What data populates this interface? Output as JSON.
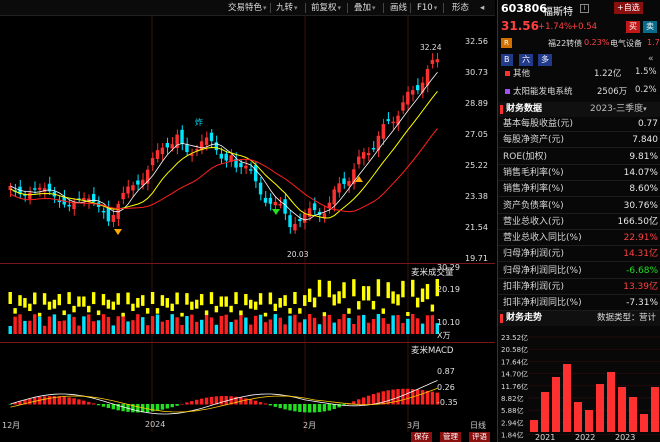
{
  "toolbar": {
    "trade_feature": "交易特色",
    "nine_turn": "九转",
    "pre_adjust": "前复权",
    "overlay": "叠加",
    "draw_line": "画线",
    "f10": "F10",
    "shape": "形态"
  },
  "main_chart": {
    "price_axis": [
      "32.56",
      "30.73",
      "28.89",
      "27.05",
      "25.22",
      "23.38",
      "21.54",
      "19.71"
    ],
    "high_label": "32.24",
    "low_label": "20.03",
    "marker_label": "炸",
    "colors": {
      "up": "#ff3030",
      "down": "#00e5ff",
      "ma5": "#ffffff",
      "ma10": "#ffff00",
      "ma20": "#ff2020"
    }
  },
  "volume_panel": {
    "title": "麦米成交量",
    "axis": [
      "30.29",
      "20.19",
      "10.10"
    ],
    "unit": "X万"
  },
  "macd_panel": {
    "title": "麦米MACD",
    "axis": [
      "0.87",
      "0.26",
      "-0.35"
    ]
  },
  "x_axis": [
    "12月",
    "2024",
    "2月",
    "3月",
    "日线"
  ],
  "quote": {
    "code": "603806",
    "name": "福斯特",
    "price": "31.56",
    "change_pct": "+1.74%",
    "change": "+0.54",
    "buy_label": "买",
    "sell_label": "卖",
    "watchlist_label": "自选",
    "r_badge": "R",
    "convertible": "福22转债",
    "convertible_pct": "0.23%",
    "sector": "电气设备",
    "sector_pct": "1.73",
    "tabs": [
      "B",
      "六",
      "多"
    ],
    "business": [
      {
        "name": "其他",
        "value": "1.22亿",
        "pct": "1.5%"
      },
      {
        "name": "太阳能发电系统",
        "value": "2506万",
        "pct": "0.2%"
      }
    ]
  },
  "financials": {
    "title": "财务数据",
    "period": "2023-三季度",
    "rows": [
      {
        "label": "基本每股收益(元)",
        "value": "0.77"
      },
      {
        "label": "每股净资产(元)",
        "value": "7.840"
      },
      {
        "label": "ROE(加权)",
        "value": "9.81%"
      },
      {
        "label": "销售毛利率(%)",
        "value": "14.07%"
      },
      {
        "label": "销售净利率(%)",
        "value": "8.60%"
      },
      {
        "label": "资产负债率(%)",
        "value": "30.76%"
      },
      {
        "label": "营业总收入(元)",
        "value": "166.50亿"
      },
      {
        "label": "营业总收入同比(%)",
        "value": "22.91%"
      },
      {
        "label": "归母净利润(元)",
        "value": "14.31亿"
      },
      {
        "label": "归母净利润同比(%)",
        "value": "-6.68%"
      },
      {
        "label": "扣非净利润(元)",
        "value": "13.39亿"
      },
      {
        "label": "扣非净利润同比(%)",
        "value": "-7.31%"
      }
    ]
  },
  "trend": {
    "title": "财务走势",
    "data_type_label": "数据类型：",
    "data_type_value": "营计",
    "y_axis": [
      "23.52亿",
      "20.58亿",
      "17.64亿",
      "14.70亿",
      "11.76亿",
      "8.82亿",
      "5.88亿",
      "2.94亿",
      "1.84亿"
    ],
    "x_axis": [
      "2021",
      "2022",
      "2023"
    ]
  },
  "bottom_buttons": [
    "保存",
    "管理",
    "评语"
  ]
}
